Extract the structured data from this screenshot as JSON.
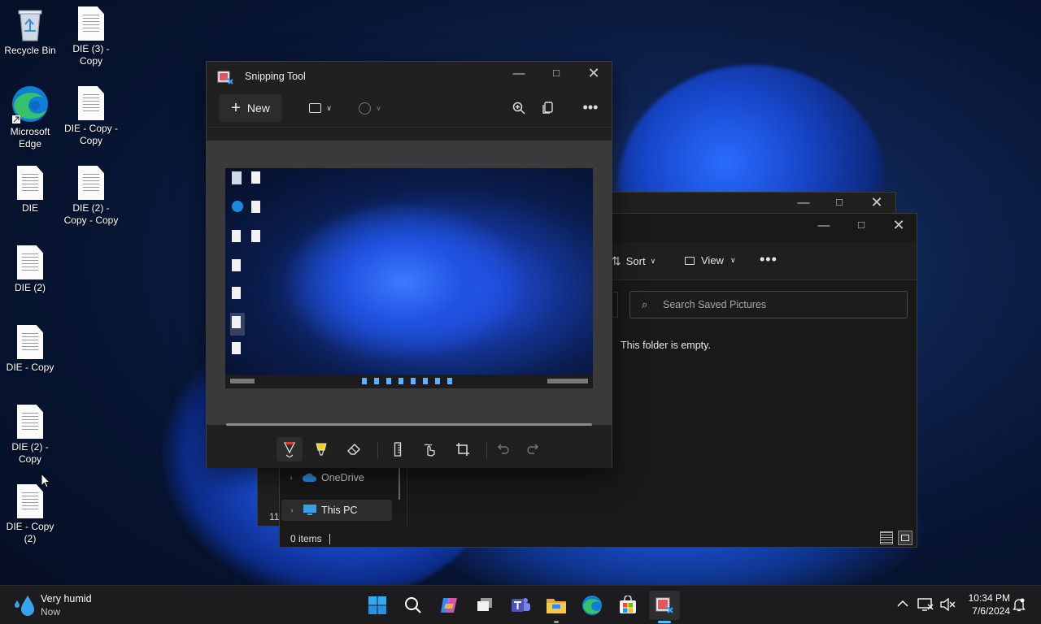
{
  "desktop": {
    "icons": [
      {
        "label": "Recycle Bin",
        "icon": "recycle-bin-icon"
      },
      {
        "label": "DIE (3) - Copy",
        "icon": "document-icon"
      },
      {
        "label": "Microsoft Edge",
        "icon": "edge-icon"
      },
      {
        "label": "DIE - Copy - Copy",
        "icon": "document-icon"
      },
      {
        "label": "DIE",
        "icon": "document-icon"
      },
      {
        "label": "DIE (2) - Copy - Copy",
        "icon": "document-icon"
      },
      {
        "label": "DIE (2)",
        "icon": "document-icon"
      },
      {
        "label": "DIE - Copy",
        "icon": "document-icon"
      },
      {
        "label": "DIE (2) - Copy",
        "icon": "document-icon"
      },
      {
        "label": "DIE - Copy (2)",
        "icon": "document-icon"
      }
    ]
  },
  "snipping_tool": {
    "title": "Snipping Tool",
    "new_label": "New",
    "icons": [
      "snipping-tool-icon",
      "plus-icon",
      "snip-mode-icon",
      "timer-icon",
      "zoom-icon",
      "copy-icon",
      "more-icon"
    ],
    "markup_tools": [
      "ballpoint-pen-icon",
      "highlighter-icon",
      "eraser-icon",
      "ruler-icon",
      "touch-writing-icon",
      "crop-icon",
      "undo-icon",
      "redo-icon"
    ]
  },
  "explorer": {
    "sort_label": "Sort",
    "view_label": "View",
    "search_placeholder": "Search Saved Pictures",
    "empty_message": "This folder is empty.",
    "nav": [
      {
        "label": "OneDrive",
        "icon": "onedrive-icon"
      },
      {
        "label": "This PC",
        "icon": "computer-icon"
      }
    ],
    "status": "0 items",
    "back_window_fragment": "11"
  },
  "taskbar": {
    "weather_title": "Very humid",
    "weather_sub": "Now",
    "time": "10:34 PM",
    "date": "7/6/2024",
    "apps": [
      "start-icon",
      "search-icon",
      "copilot-icon",
      "task-view-icon",
      "teams-icon",
      "file-explorer-icon",
      "edge-icon",
      "store-icon",
      "snipping-tool-icon"
    ],
    "tray": [
      "chevron-up-icon",
      "network-icon",
      "volume-muted-icon",
      "notification-icon"
    ]
  },
  "colors": {
    "accent": "#4cc2ff",
    "taskbar": "#1c1c1e",
    "window": "#202020"
  }
}
